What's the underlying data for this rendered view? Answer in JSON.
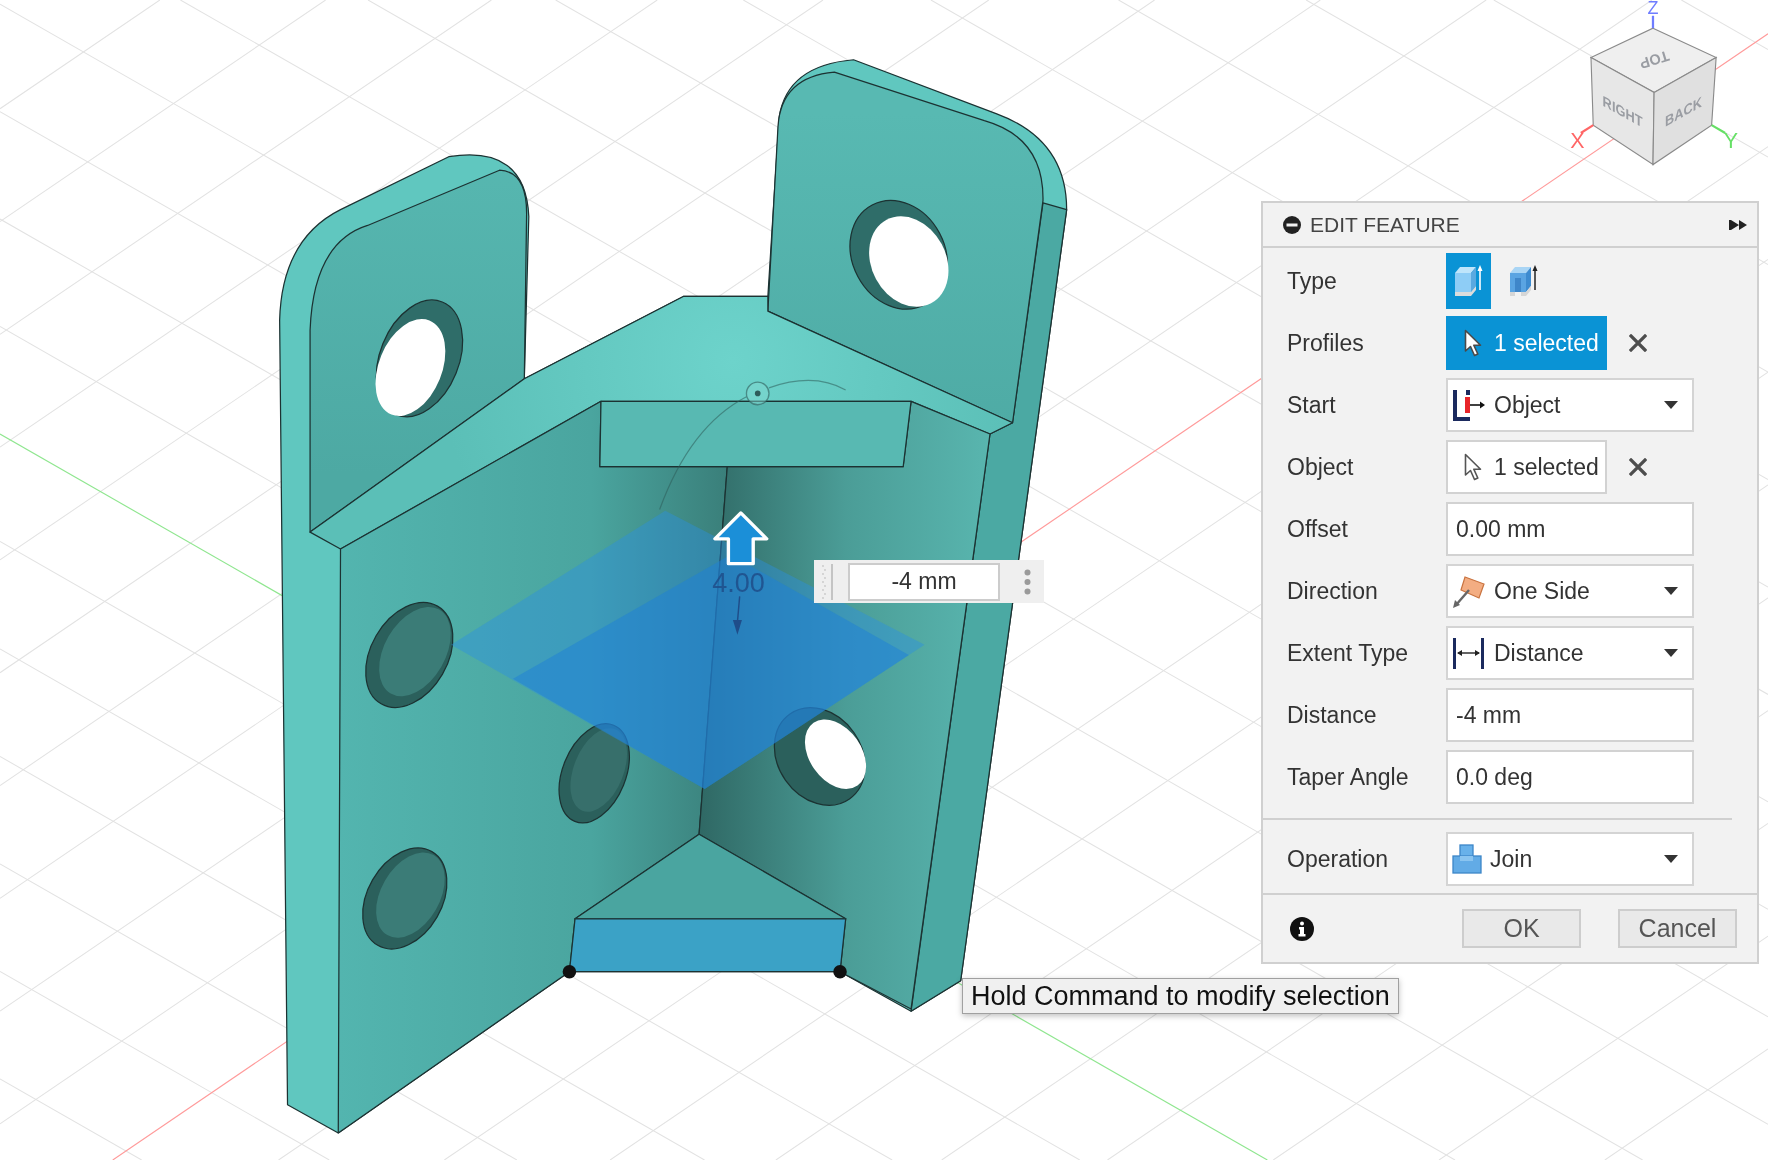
{
  "viewport": {
    "view_cube": {
      "faces": [
        "TOP",
        "RIGHT",
        "BACK"
      ],
      "axes": [
        {
          "label": "Z",
          "color": "#6f7dff"
        },
        {
          "label": "X",
          "color": "#ff6666"
        },
        {
          "label": "Y",
          "color": "#66e066"
        }
      ]
    },
    "dimension_label": "4.00",
    "dimension_input": {
      "value": "-4 mm"
    },
    "tooltip": "Hold Command to modify selection"
  },
  "panel": {
    "title": "EDIT FEATURE",
    "rows": [
      {
        "label": "Type",
        "kind": "toggle",
        "options": [
          {
            "selected": true
          },
          {
            "selected": false
          }
        ]
      },
      {
        "label": "Profiles",
        "kind": "selection",
        "value": "1 selected",
        "selected": true
      },
      {
        "label": "Start",
        "kind": "dropdown",
        "value": "Object"
      },
      {
        "label": "Object",
        "kind": "selection",
        "value": "1 selected",
        "selected": false
      },
      {
        "label": "Offset",
        "kind": "input",
        "value": "0.00 mm"
      },
      {
        "label": "Direction",
        "kind": "dropdown",
        "value": "One Side"
      },
      {
        "label": "Extent Type",
        "kind": "dropdown",
        "value": "Distance"
      },
      {
        "label": "Distance",
        "kind": "input",
        "value": "-4 mm"
      },
      {
        "label": "Taper Angle",
        "kind": "input",
        "value": "0.0 deg"
      }
    ],
    "operation": {
      "label": "Operation",
      "kind": "dropdown",
      "value": "Join"
    },
    "buttons": [
      {
        "label": "OK"
      },
      {
        "label": "Cancel"
      }
    ]
  }
}
